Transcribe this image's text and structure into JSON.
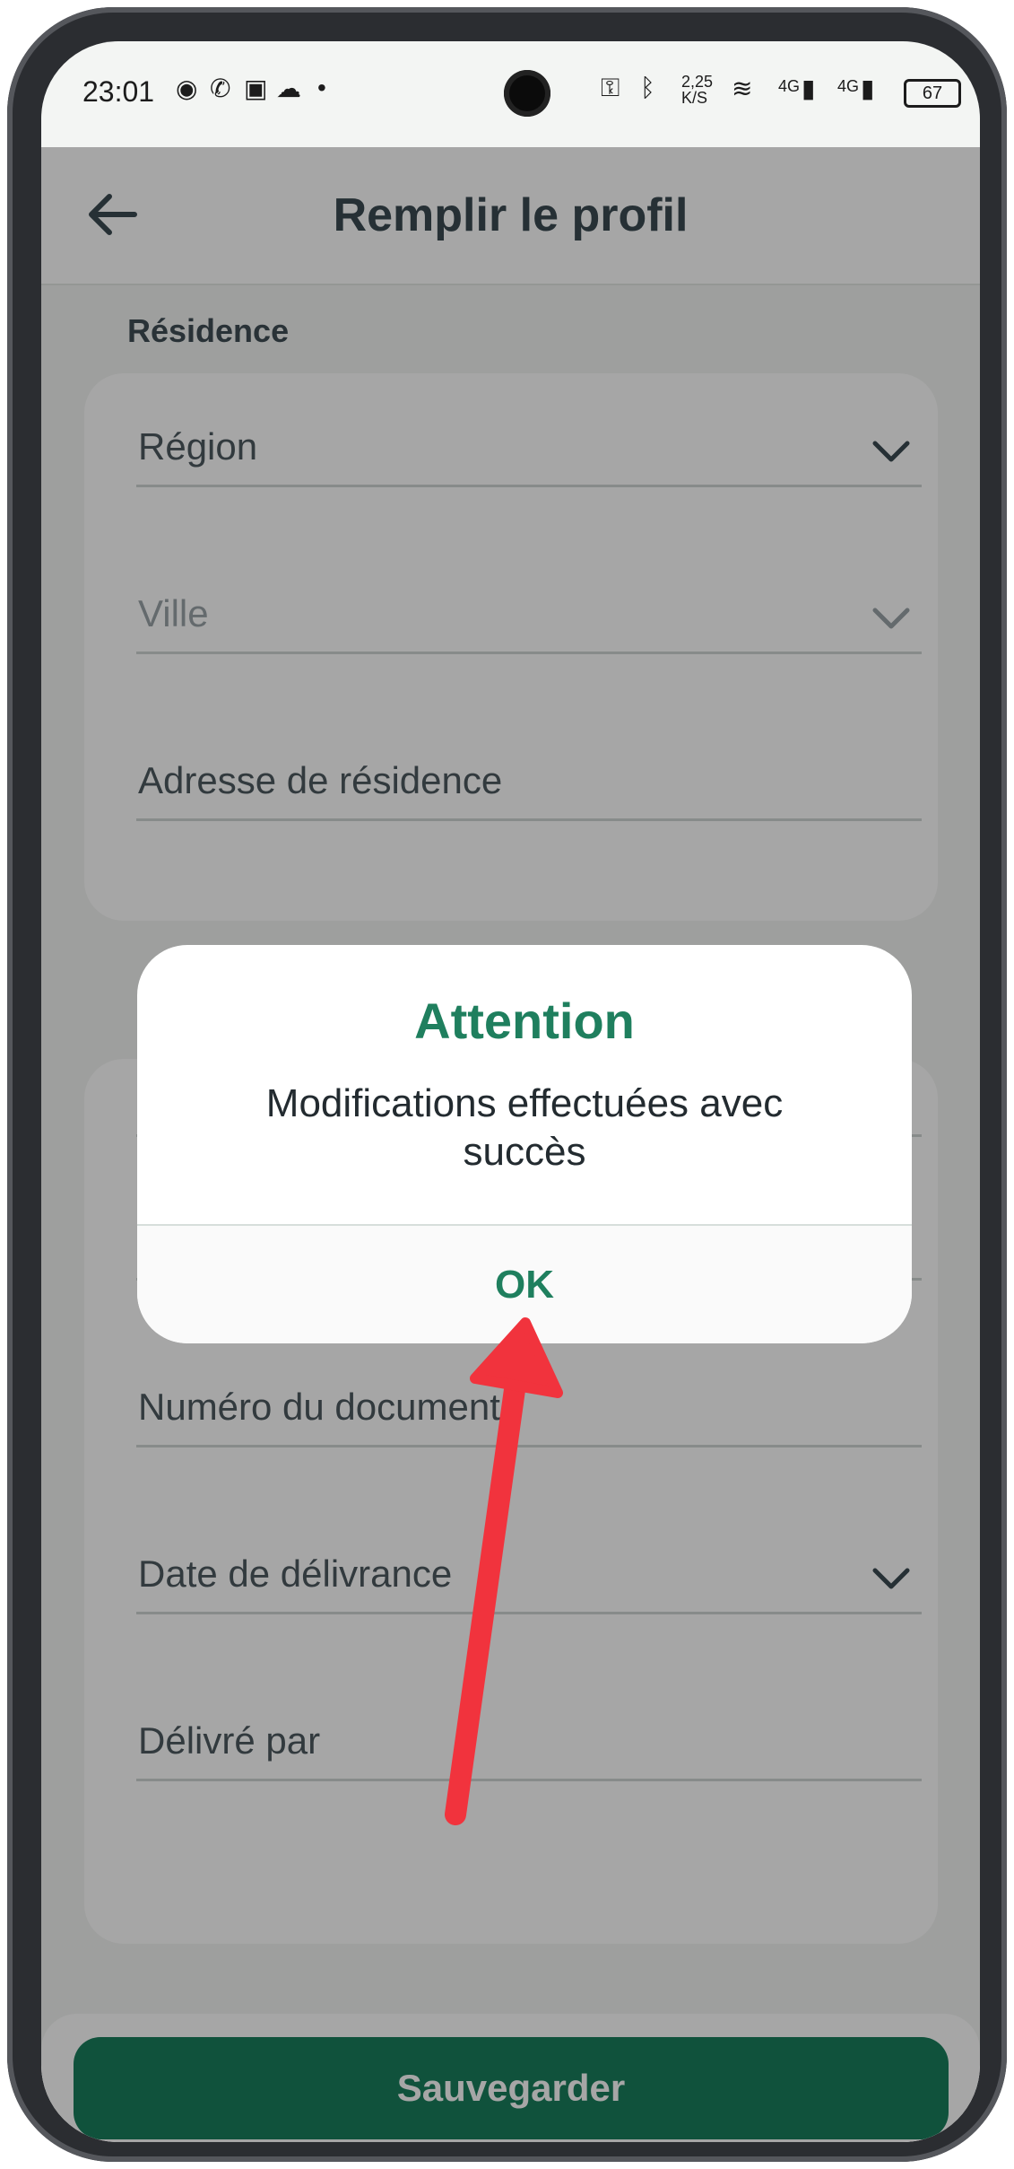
{
  "status_bar": {
    "time": "23:01",
    "speed": "2,25",
    "speed_unit": "K/S",
    "network1": "4G",
    "network2": "4G",
    "battery": "67"
  },
  "appbar": {
    "title": "Remplir le profil"
  },
  "residence": {
    "section_label": "Résidence",
    "fields": {
      "region": "Région",
      "ville": "Ville",
      "adresse": "Adresse de résidence"
    }
  },
  "document": {
    "fields": {
      "numero": "Numéro du document",
      "date": "Date de délivrance",
      "delivre_par": "Délivré par"
    }
  },
  "save_button": "Sauvegarder",
  "dialog": {
    "title": "Attention",
    "message": "Modifications effectuées avec succès",
    "ok": "OK"
  },
  "colors": {
    "accent": "#1f7f5e",
    "button": "#197f5c",
    "annotation_arrow": "#f1333d"
  }
}
